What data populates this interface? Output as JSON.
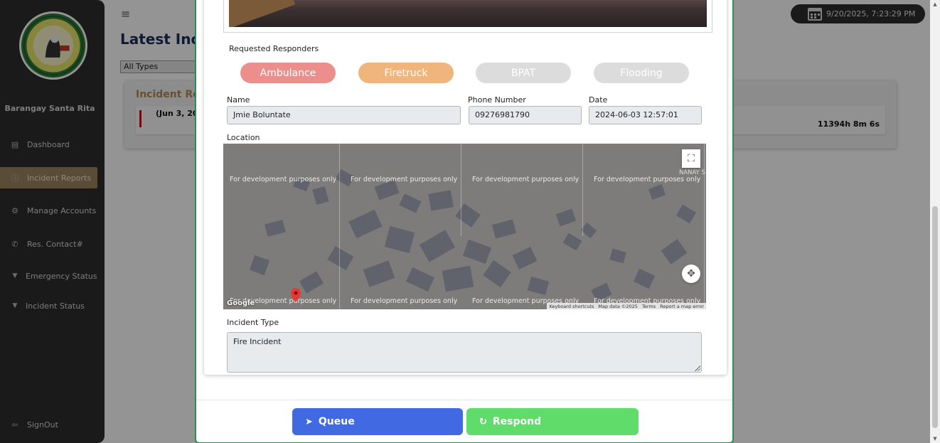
{
  "datetime": "9/20/2025, 7:23:29 PM",
  "sidebar": {
    "org_name": "Barangay Santa Rita",
    "logo_text": "BARANGAY STA RITA OLONGAPO",
    "items": [
      {
        "label": "Dashboard",
        "icon": "dashboard-icon"
      },
      {
        "label": "Incident Reports",
        "icon": "alert-circle-icon"
      },
      {
        "label": "Manage Accounts",
        "icon": "users-gear-icon"
      },
      {
        "label": "Res. Contact#",
        "icon": "phone-icon"
      },
      {
        "label": "Emergency Status",
        "icon": "caret-down-icon"
      },
      {
        "label": "Incident Status",
        "icon": "caret-down-icon"
      }
    ],
    "signout": "SignOut"
  },
  "background": {
    "menu_icon": "≡",
    "title": "Latest Incid",
    "filter_value": "All Types",
    "card_title": "Incident Rep",
    "row_date": "(Jun 3, 20",
    "row_duration": "11394h 8m 6s"
  },
  "modal": {
    "requested_responders_label": "Requested Responders",
    "responders": [
      {
        "label": "Ambulance",
        "color": "#ec8f8c"
      },
      {
        "label": "Firetruck",
        "color": "#f0b57c"
      },
      {
        "label": "BPAT",
        "color": "#dcdcdc"
      },
      {
        "label": "Flooding",
        "color": "#dcdcdc"
      }
    ],
    "name_label": "Name",
    "name_value": "Jmie Boluntate",
    "phone_label": "Phone Number",
    "phone_value": "09276981790",
    "date_label": "Date",
    "date_value": "2024-06-03 12:57:01",
    "location_label": "Location",
    "map": {
      "watermark": "For development purposes only",
      "place_label": "NANAY S",
      "google": "Google",
      "attrib_shortcuts": "Keyboard shortcuts",
      "attrib_data": "Map data ©2025",
      "attrib_terms": "Terms",
      "attrib_report": "Report a map error"
    },
    "incident_type_label": "Incident Type",
    "incident_type_value": "Fire Incident",
    "queue_label": "Queue",
    "respond_label": "Respond",
    "queue_color": "#4169e1",
    "respond_color": "#5fdc6a"
  }
}
